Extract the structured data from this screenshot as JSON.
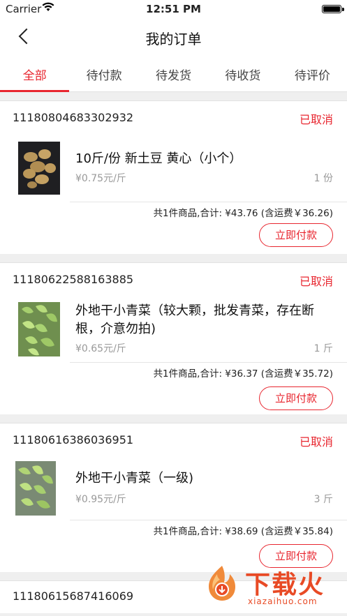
{
  "status_bar": {
    "carrier": "Carrier",
    "time": "12:51 PM"
  },
  "nav": {
    "title": "我的订单"
  },
  "tabs": [
    {
      "label": "全部",
      "active": true
    },
    {
      "label": "待付款",
      "active": false
    },
    {
      "label": "待发货",
      "active": false
    },
    {
      "label": "待收货",
      "active": false
    },
    {
      "label": "待评价",
      "active": false
    }
  ],
  "orders": [
    {
      "order_no": "11180804683302932",
      "status": "已取消",
      "item_name": "10斤/份 新土豆 黄心（小个）",
      "item_price": "¥0.75元/斤",
      "item_qty": "1 份",
      "summary": "共1件商品,合计: ¥43.76 (含运费￥36.26)",
      "action": "立即付款"
    },
    {
      "order_no": "11180622588163885",
      "status": "已取消",
      "item_name": "外地干小青菜（较大颗，批发青菜，存在断根，介意勿拍)",
      "item_price": "¥0.65元/斤",
      "item_qty": "1 斤",
      "summary": "共1件商品,合计: ¥36.37 (含运费￥35.72)",
      "action": "立即付款"
    },
    {
      "order_no": "11180616386036951",
      "status": "已取消",
      "item_name": "外地干小青菜（一级)",
      "item_price": "¥0.95元/斤",
      "item_qty": "3 斤",
      "summary": "共1件商品,合计: ¥38.69 (含运费￥35.84)",
      "action": "立即付款"
    },
    {
      "order_no": "11180615687416069"
    }
  ],
  "watermark": {
    "text": "下载火",
    "sub": "xiazaihuo.com"
  },
  "colors": {
    "accent": "#e8262f"
  }
}
